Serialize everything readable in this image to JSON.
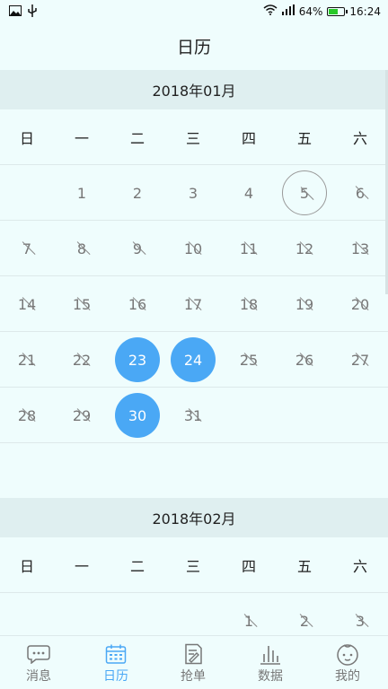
{
  "status_bar": {
    "battery": "64%",
    "time": "16:24",
    "battery_level": 0.64,
    "icons": [
      "image-icon",
      "usb-icon",
      "wifi-icon",
      "signal-icon",
      "battery-icon"
    ]
  },
  "title": "日历",
  "weekdays": [
    "日",
    "一",
    "二",
    "三",
    "四",
    "五",
    "六"
  ],
  "months": [
    {
      "header": "2018年01月",
      "weeks": [
        [
          null,
          "1",
          "2",
          "3",
          "4",
          "5",
          "6"
        ],
        [
          "7",
          "8",
          "9",
          "10",
          "11",
          "12",
          "13"
        ],
        [
          "14",
          "15",
          "16",
          "17",
          "18",
          "19",
          "20"
        ],
        [
          "21",
          "22",
          "23",
          "24",
          "25",
          "26",
          "27"
        ],
        [
          "28",
          "29",
          "30",
          "31",
          null,
          null,
          null
        ]
      ],
      "past": [
        "5",
        "6",
        "7",
        "8",
        "9",
        "10",
        "11",
        "12",
        "13",
        "14",
        "15",
        "16",
        "17",
        "18",
        "19",
        "20",
        "21",
        "22",
        "25",
        "26",
        "27",
        "28",
        "29",
        "31"
      ],
      "selected": [
        "23",
        "24",
        "30"
      ],
      "today": "5"
    },
    {
      "header": "2018年02月",
      "weeks": [
        [
          null,
          null,
          null,
          null,
          "1",
          "2",
          "3"
        ]
      ],
      "past": [
        "1",
        "2",
        "3"
      ],
      "selected": [],
      "today": null
    }
  ],
  "tabs": [
    {
      "label": "消息",
      "icon": "message-icon",
      "active": false
    },
    {
      "label": "日历",
      "icon": "calendar-icon",
      "active": true
    },
    {
      "label": "抢单",
      "icon": "order-icon",
      "active": false
    },
    {
      "label": "数据",
      "icon": "chart-icon",
      "active": false
    },
    {
      "label": "我的",
      "icon": "profile-icon",
      "active": false
    }
  ],
  "colors": {
    "background": "#effdfd",
    "month_header_bg": "#dfeff0",
    "accent": "#4aa8f5",
    "text_muted": "#777777"
  }
}
